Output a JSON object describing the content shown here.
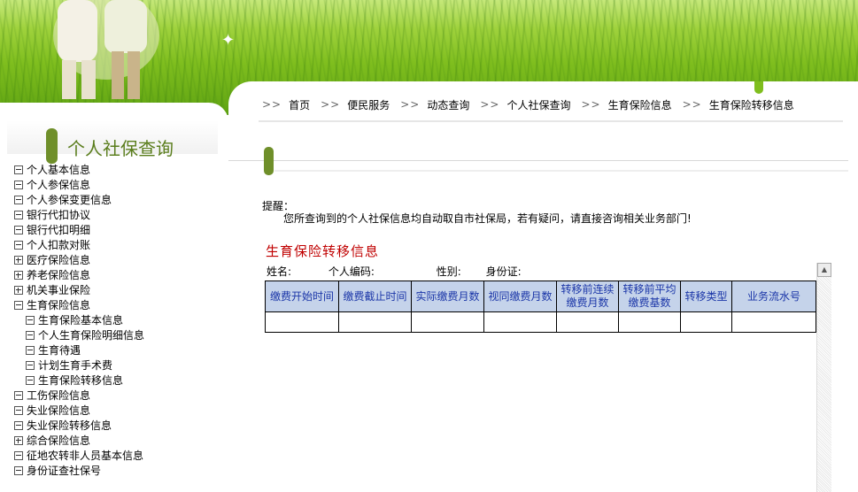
{
  "breadcrumb": {
    "separator": ">>",
    "items": [
      "首页",
      "便民服务",
      "动态查询",
      "个人社保查询",
      "生育保险信息",
      "生育保险转移信息"
    ]
  },
  "sidebar": {
    "title": "个人社保查询",
    "items": [
      {
        "label": "个人基本信息",
        "toggle": "minus"
      },
      {
        "label": "个人参保信息",
        "toggle": "minus"
      },
      {
        "label": "个人参保变更信息",
        "toggle": "minus"
      },
      {
        "label": "银行代扣协议",
        "toggle": "minus"
      },
      {
        "label": "银行代扣明细",
        "toggle": "minus"
      },
      {
        "label": "个人扣款对账",
        "toggle": "minus"
      },
      {
        "label": "医疗保险信息",
        "toggle": "plus"
      },
      {
        "label": "养老保险信息",
        "toggle": "plus"
      },
      {
        "label": "机关事业保险",
        "toggle": "plus"
      },
      {
        "label": "生育保险信息",
        "toggle": "minus"
      },
      {
        "label": "生育保险基本信息",
        "toggle": "minus",
        "child": true
      },
      {
        "label": "个人生育保险明细信息",
        "toggle": "minus",
        "child": true
      },
      {
        "label": "生育待遇",
        "toggle": "minus",
        "child": true
      },
      {
        "label": "计划生育手术费",
        "toggle": "minus",
        "child": true
      },
      {
        "label": "生育保险转移信息",
        "toggle": "minus",
        "child": true
      },
      {
        "label": "工伤保险信息",
        "toggle": "minus"
      },
      {
        "label": "失业保险信息",
        "toggle": "minus"
      },
      {
        "label": "失业保险转移信息",
        "toggle": "minus"
      },
      {
        "label": "综合保险信息",
        "toggle": "plus"
      },
      {
        "label": "征地农转非人员基本信息",
        "toggle": "minus"
      },
      {
        "label": "身份证查社保号",
        "toggle": "minus"
      }
    ]
  },
  "reminder": {
    "label": "提醒：",
    "text": "您所查询到的个人社保信息均自动取自市社保局，若有疑问，请直接咨询相关业务部门!"
  },
  "section": {
    "title": "生育保险转移信息",
    "fields": {
      "name_label": "姓名:",
      "id_label": "个人编码:",
      "gender_label": "性别:",
      "idcard_label": "身份证:"
    }
  },
  "table": {
    "headers": [
      "缴费开始时间",
      "缴费截止时间",
      "实际缴费月数",
      "视同缴费月数",
      "转移前连续缴费月数",
      "转移前平均缴费基数",
      "转移类型",
      "业务流水号"
    ],
    "rows": [
      [
        "",
        "",
        "",
        "",
        "",
        "",
        "",
        ""
      ]
    ]
  },
  "colors": {
    "header_green": "#7fbe1e",
    "section_title": "#c00000",
    "table_header_bg": "#c5d3ea",
    "table_header_text": "#1b36a8",
    "sidebar_title": "#5a7d1c"
  }
}
